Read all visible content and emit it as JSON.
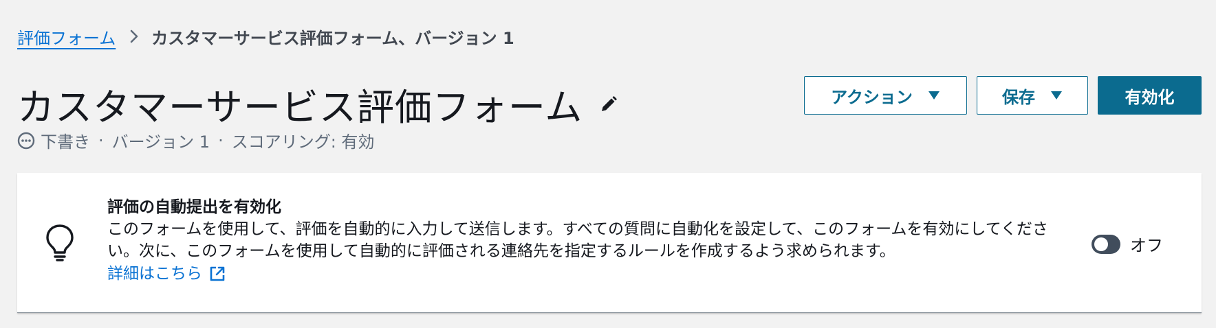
{
  "breadcrumb": {
    "parent": "評価フォーム",
    "current": "カスタマーサービス評価フォーム、バージョン 1"
  },
  "header": {
    "title": "カスタマーサービス評価フォーム",
    "status": "下書き",
    "version": "バージョン 1",
    "scoring": "スコアリング: 有効",
    "separator": "·"
  },
  "actions": {
    "action_label": "アクション",
    "save_label": "保存",
    "activate_label": "有効化"
  },
  "auto_submit_panel": {
    "title": "評価の自動提出を有効化",
    "description": "このフォームを使用して、評価を自動的に入力して送信します。すべての質問に自動化を設定して、このフォームを有効にしてください。次に、このフォームを使用して自動的に評価される連絡先を指定するルールを作成するよう求められます。",
    "learn_more": "詳細はこちら",
    "toggle_label": "オフ",
    "toggle_on": false
  },
  "colors": {
    "link": "#0972d3",
    "primary": "#0b6b8f",
    "background": "#f2f2f2"
  },
  "icons": [
    "chevron-right-icon",
    "pencil-icon",
    "status-pending-icon",
    "caret-down-icon",
    "lightbulb-icon",
    "external-link-icon"
  ]
}
